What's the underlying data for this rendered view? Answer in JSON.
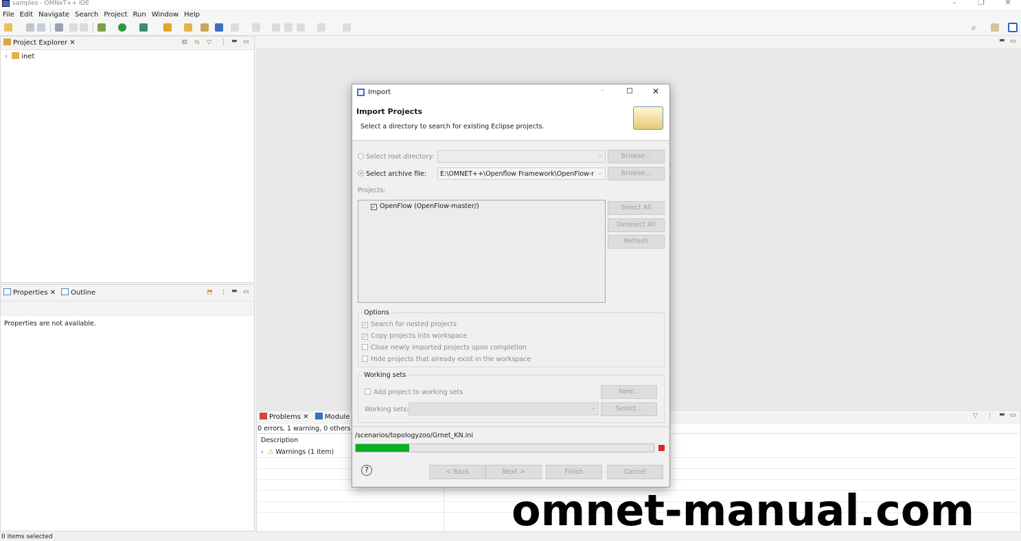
{
  "window": {
    "title": "samples - OMNeT++ IDE"
  },
  "menu": [
    "File",
    "Edit",
    "Navigate",
    "Search",
    "Project",
    "Run",
    "Window",
    "Help"
  ],
  "project_explorer": {
    "tab": "Project Explorer",
    "items": [
      {
        "label": "inet"
      }
    ]
  },
  "properties": {
    "tab_properties": "Properties",
    "tab_outline": "Outline",
    "message": "Properties are not available."
  },
  "problems": {
    "tab_problems": "Problems",
    "tab_module": "Module",
    "summary": "0 errors, 1 warning, 0 others",
    "column_description": "Description",
    "rows": [
      {
        "label": "Warnings (1 item)"
      }
    ]
  },
  "status": {
    "left": "0 items selected"
  },
  "dialog": {
    "title": "Import",
    "heading": "Import Projects",
    "subheading": "Select a directory to search for existing Eclipse projects.",
    "root_dir_label": "Select root directory:",
    "archive_label": "Select archive file:",
    "archive_value": "E:\\OMNET++\\Openflow Framework\\OpenFlow-m",
    "browse1": "Browse...",
    "browse2": "Browse...",
    "projects_label": "Projects:",
    "projects": [
      {
        "label": "OpenFlow (OpenFlow-master/)",
        "checked": true
      }
    ],
    "select_all": "Select All",
    "deselect_all": "Deselect All",
    "refresh": "Refresh",
    "options_title": "Options",
    "options": [
      {
        "label": "Search for nested projects",
        "checked": true
      },
      {
        "label": "Copy projects into workspace",
        "checked": true
      },
      {
        "label": "Close newly imported projects upon completion",
        "checked": false
      },
      {
        "label": "Hide projects that already exist in the workspace",
        "checked": false
      }
    ],
    "working_sets_title": "Working sets",
    "add_to_ws": "Add project to working sets",
    "new_btn": "New...",
    "ws_label": "Working sets:",
    "select_btn": "Select...",
    "progress_text": "/scenarios/topologyzoo/Grnet_KN.ini",
    "progress": 0.18,
    "help": "?",
    "back": "< Back",
    "next": "Next >",
    "finish": "Finish",
    "cancel": "Cancel"
  },
  "watermark": "omnet-manual.com",
  "colors": {
    "progress": "#06b025",
    "stop": "#d42a2a",
    "accent": "#2a62c9"
  }
}
